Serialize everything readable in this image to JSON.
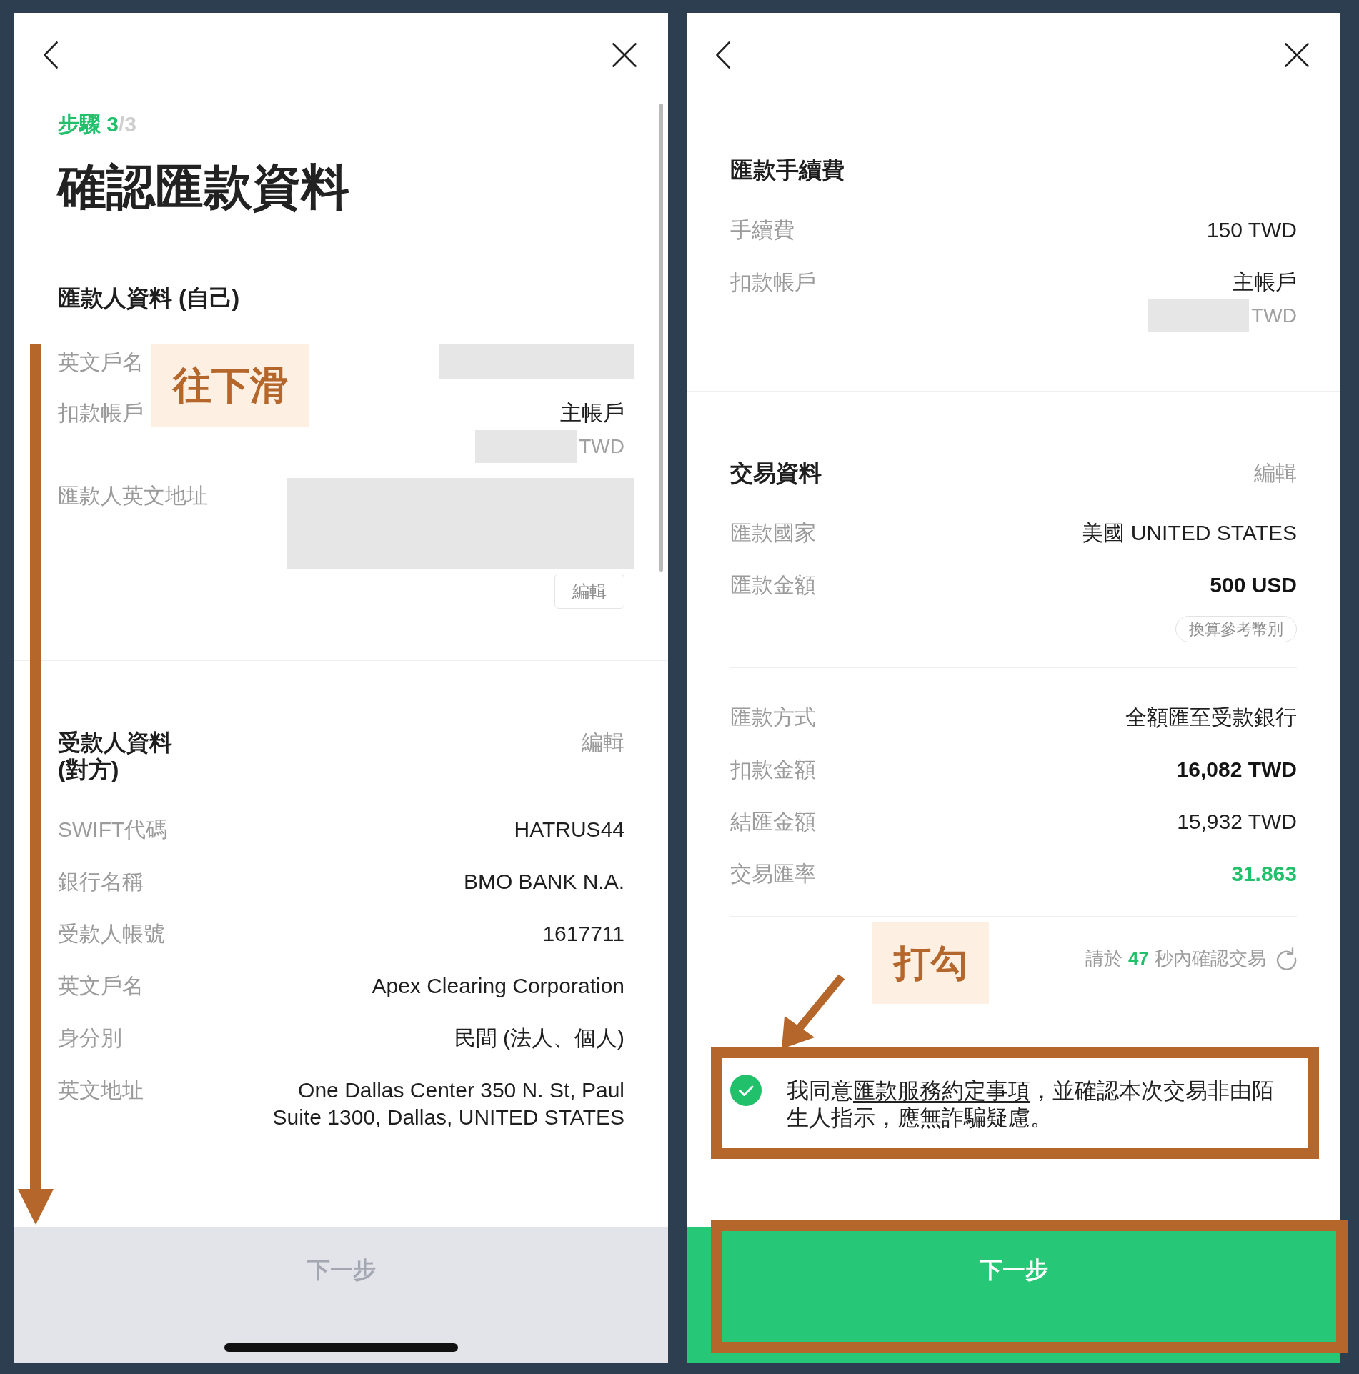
{
  "left_screen": {
    "step": {
      "done": "步驟 3",
      "rest": "/3"
    },
    "title": "確認匯款資料",
    "sections": [
      {
        "title": "匯款人資料 (自己)",
        "edit_button": "編輯",
        "groups": [
          {
            "rows": [
              {
                "kind": "redacted_line",
                "label": "英文戶名"
              },
              {
                "kind": "account",
                "label": "扣款帳戶",
                "value": "主帳戶",
                "currency": "TWD"
              },
              {
                "kind": "redacted_area",
                "label": "匯款人英文地址"
              }
            ]
          }
        ]
      },
      {
        "title": "受款人資料 (對方)",
        "edit_link": "編輯",
        "groups": [
          {
            "rows": [
              {
                "kind": "text",
                "label": "SWIFT代碼",
                "value": "HATRUS44"
              },
              {
                "kind": "text",
                "label": "銀行名稱",
                "value": "BMO BANK N.A."
              },
              {
                "kind": "text",
                "label": "受款人帳號",
                "value": "1617711"
              },
              {
                "kind": "text",
                "label": "英文戶名",
                "value": "Apex Clearing Corporation"
              },
              {
                "kind": "text",
                "label": "身分別",
                "value": "民間 (法人、個人)"
              },
              {
                "kind": "multiline",
                "label": "英文地址",
                "lines": [
                  "One Dallas Center 350 N. St, Paul",
                  "Suite 1300, Dallas, UNITED STATES"
                ]
              }
            ]
          }
        ]
      }
    ],
    "annotation": {
      "kind": "scroll_hint",
      "label": "往下滑"
    },
    "next_button": {
      "label": "下一步",
      "disabled": true
    }
  },
  "right_screen": {
    "sections": [
      {
        "title": "匯款手續費",
        "groups": [
          {
            "rows": [
              {
                "kind": "text",
                "label": "手續費",
                "value": "150 TWD"
              },
              {
                "kind": "account",
                "label": "扣款帳戶",
                "value": "主帳戶",
                "currency": "TWD"
              }
            ]
          }
        ]
      },
      {
        "title": "交易資料",
        "edit_link": "編輯",
        "groups": [
          {
            "rows": [
              {
                "kind": "text",
                "label": "匯款國家",
                "value": "美國 UNITED STATES"
              },
              {
                "kind": "bold",
                "label": "匯款金額",
                "value": "500 USD",
                "chip": "換算參考幣別"
              }
            ]
          },
          {
            "rows": [
              {
                "kind": "text",
                "label": "匯款方式",
                "value": "全額匯至受款銀行"
              },
              {
                "kind": "bold",
                "label": "扣款金額",
                "value": "16,082 TWD"
              },
              {
                "kind": "text",
                "label": "結匯金額",
                "value": "15,932 TWD"
              },
              {
                "kind": "accent",
                "label": "交易匯率",
                "value": "31.863"
              }
            ]
          }
        ],
        "countdown": {
          "before": "請於",
          "seconds": "47",
          "after": "秒內確認交易"
        }
      }
    ],
    "consent": {
      "checked": true,
      "before": "我同意",
      "link": "匯款服務約定事項",
      "after": "，並確認本次交易非由陌生人指示，應無詐騙疑慮。"
    },
    "annotation": {
      "kind": "check_hint",
      "label": "打勾"
    },
    "next_button": {
      "label": "下一步",
      "disabled": false
    }
  }
}
